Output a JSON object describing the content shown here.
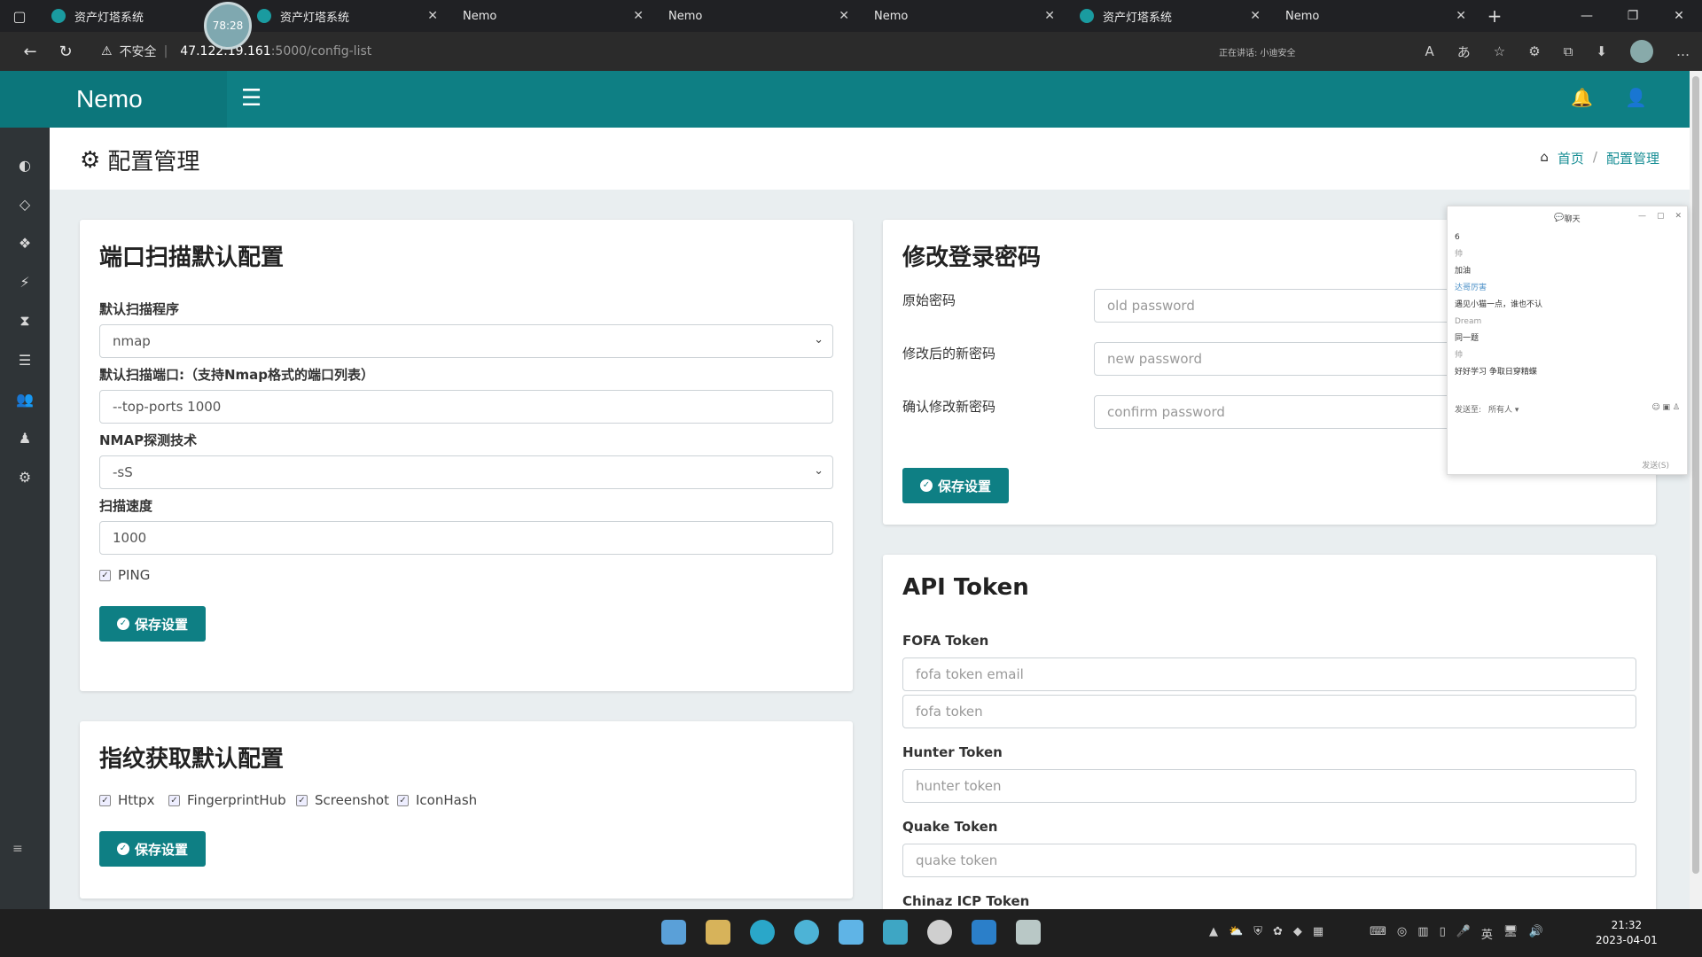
{
  "browser": {
    "tabs": [
      {
        "label": "资产灯塔系统",
        "type": "asset"
      },
      {
        "label": "资产灯塔系统",
        "type": "asset"
      },
      {
        "label": "Nemo",
        "type": "page"
      },
      {
        "label": "Nemo",
        "type": "page"
      },
      {
        "label": "Nemo",
        "type": "page"
      },
      {
        "label": "资产灯塔系统",
        "type": "asset"
      },
      {
        "label": "Nemo",
        "type": "page"
      }
    ],
    "avatar_bubble_text": "78:28",
    "insecure_label": "不安全",
    "url_host": "47.122.19.161",
    "url_path": ":5000/config-list",
    "status_text": "正在讲话: 小迪安全"
  },
  "app": {
    "brand": "Nemo",
    "page_title": "配置管理",
    "breadcrumb": {
      "home": "首页",
      "current": "配置管理"
    }
  },
  "port_scan": {
    "title": "端口扫描默认配置",
    "program_label": "默认扫描程序",
    "program_value": "nmap",
    "ports_label": "默认扫描端口:（支持Nmap格式的端口列表）",
    "ports_value": "--top-ports 1000",
    "tech_label": "NMAP探测技术",
    "tech_value": "-sS",
    "speed_label": "扫描速度",
    "speed_value": "1000",
    "ping_label": "PING",
    "save_label": "保存设置"
  },
  "fingerprint": {
    "title": "指纹获取默认配置",
    "options": [
      "Httpx",
      "FingerprintHub",
      "Screenshot",
      "IconHash"
    ],
    "save_label": "保存设置"
  },
  "password": {
    "title": "修改登录密码",
    "old_label": "原始密码",
    "old_placeholder": "old password",
    "new_label": "修改后的新密码",
    "new_placeholder": "new password",
    "confirm_label": "确认修改新密码",
    "confirm_placeholder": "confirm password",
    "save_label": "保存设置"
  },
  "api_token": {
    "title": "API Token",
    "fofa_label": "FOFA Token",
    "fofa_email_placeholder": "fofa token email",
    "fofa_token_placeholder": "fofa token",
    "hunter_label": "Hunter Token",
    "hunter_placeholder": "hunter token",
    "quake_label": "Quake Token",
    "quake_placeholder": "quake token",
    "chinaz_label": "Chinaz ICP Token"
  },
  "chat": {
    "title": "聊天",
    "messages": [
      "6",
      "帅",
      "加油",
      "达哥厉害",
      "遇见小猫一点，谁也不认",
      "Dream",
      "同一题",
      "帅",
      "好好学习 争取日穿精蝶"
    ],
    "send_to": "发送至:",
    "send_target": "所有人",
    "send_button": "发送(S)"
  },
  "taskbar": {
    "ime": "英",
    "time": "21:32",
    "date": "2023-04-01"
  },
  "colors": {
    "accent": "#0e7f84",
    "sidebar": "#2f3437"
  }
}
